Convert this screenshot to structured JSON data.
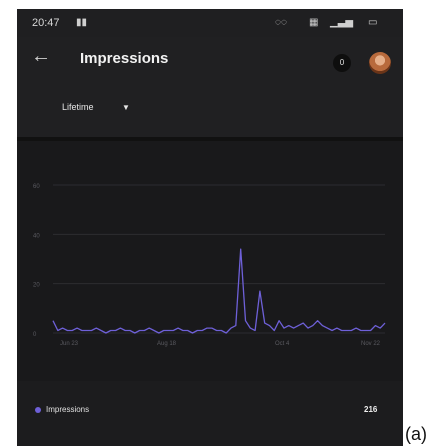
{
  "status_bar": {
    "time": "20:47",
    "icons": [
      "notification-icon",
      "alarm-icon",
      "wifi-icon",
      "signal-icon",
      "battery-icon"
    ]
  },
  "header": {
    "title": "Impressions",
    "notification_count": "0"
  },
  "filter": {
    "range": "Lifetime"
  },
  "colors": {
    "accent": "#6e60d8",
    "background": "#1c1c1e"
  },
  "chart_data": {
    "type": "line",
    "y_ticks": [
      "60",
      "40",
      "20",
      "0"
    ],
    "ylim": [
      0,
      60
    ],
    "x_ticks": [
      "Jun 23",
      "Aug 18",
      "Oct 4",
      "Nov 22"
    ],
    "grid": true,
    "series": [
      {
        "name": "Impressions",
        "values": [
          5,
          1,
          2,
          1,
          1,
          2,
          1,
          1,
          1,
          2,
          1,
          0,
          1,
          1,
          2,
          1,
          1,
          0,
          1,
          1,
          2,
          1,
          0,
          1,
          1,
          1,
          2,
          1,
          1,
          0,
          1,
          1,
          2,
          2,
          1,
          1,
          0,
          2,
          3,
          34,
          5,
          2,
          1,
          17,
          4,
          3,
          1,
          5,
          2,
          3,
          2,
          3,
          4,
          2,
          3,
          5,
          3,
          2,
          1,
          2,
          1,
          1,
          1,
          2,
          1,
          1,
          1,
          3,
          2,
          4
        ]
      }
    ]
  },
  "legend": {
    "label": "Impressions",
    "value": "216"
  },
  "caption": "(a)"
}
